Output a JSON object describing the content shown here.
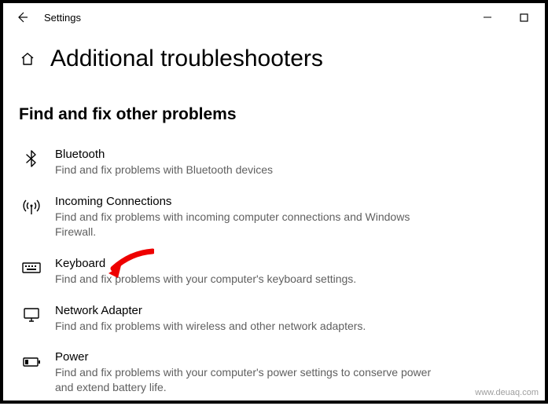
{
  "window": {
    "title": "Settings",
    "page_title": "Additional troubleshooters",
    "section_title": "Find and fix other problems"
  },
  "items": [
    {
      "name": "Bluetooth",
      "desc": "Find and fix problems with Bluetooth devices"
    },
    {
      "name": "Incoming Connections",
      "desc": "Find and fix problems with incoming computer connections and Windows Firewall."
    },
    {
      "name": "Keyboard",
      "desc": "Find and fix problems with your computer's keyboard settings."
    },
    {
      "name": "Network Adapter",
      "desc": "Find and fix problems with wireless and other network adapters."
    },
    {
      "name": "Power",
      "desc": "Find and fix problems with your computer's power settings to conserve power and extend battery life."
    }
  ],
  "watermark": "www.deuaq.com"
}
